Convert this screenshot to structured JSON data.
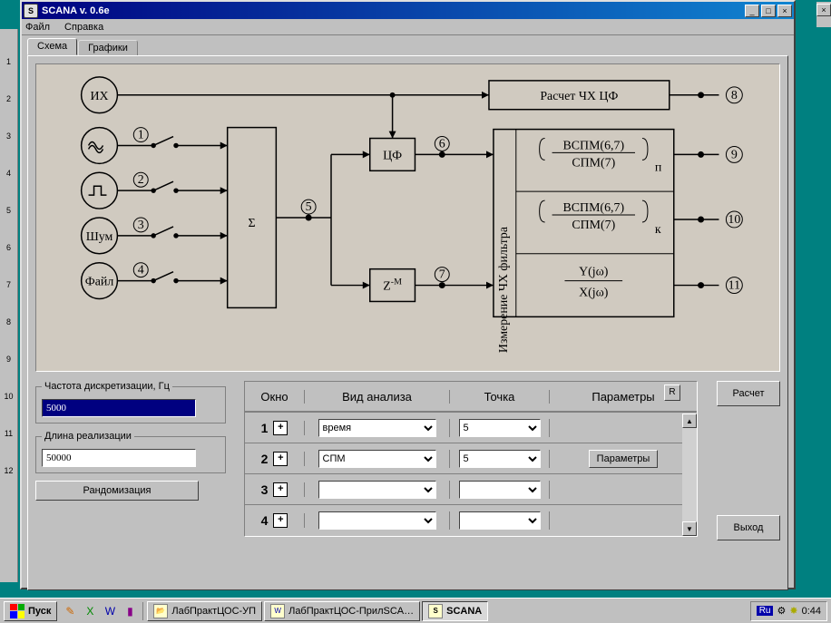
{
  "window": {
    "title": "SCANA v. 0.6e",
    "sysicon": "S"
  },
  "menu": {
    "file": "Файл",
    "help": "Справка"
  },
  "tabs": {
    "schema": "Схема",
    "graphs": "Графики"
  },
  "diagram": {
    "nodes": {
      "ih": "ИХ",
      "wave": "≈",
      "pulse": "⎍",
      "noise": "Шум",
      "file": "Файл",
      "sum": "Σ",
      "cf_filter": "ЦФ",
      "delay": "Z⁻ᴹ",
      "calc_chcf": "Расчет ЧХ ЦФ",
      "measure_block": "Измерение ЧХ фильтра",
      "ratio1_top": "ВСПМ(6,7)",
      "ratio1_bot": "СПМ(7)",
      "ratio1_sub": "п",
      "ratio2_top": "ВСПМ(6,7)",
      "ratio2_bot": "СПМ(7)",
      "ratio2_sub": "к",
      "ratio3_top": "Y(jω)",
      "ratio3_bot": "X(jω)"
    },
    "labels": {
      "n1": "1",
      "n2": "2",
      "n3": "3",
      "n4": "4",
      "n5": "5",
      "n6": "6",
      "n7": "7",
      "n8": "8",
      "n9": "9",
      "n10": "10",
      "n11": "11"
    }
  },
  "params": {
    "sample_rate_label": "Частота дискретизации, Гц",
    "sample_rate_value": "5000",
    "length_label": "Длина реализации",
    "length_value": "50000",
    "randomize": "Рандомизация"
  },
  "analysis": {
    "headers": {
      "okno": "Окно",
      "vid": "Вид анализа",
      "pt": "Точка",
      "par": "Параметры"
    },
    "r_btn": "R",
    "plus": "+",
    "rows": [
      {
        "n": "1",
        "vid": "время",
        "pt": "5",
        "par": ""
      },
      {
        "n": "2",
        "vid": "СПМ",
        "pt": "5",
        "par": "Параметры"
      },
      {
        "n": "3",
        "vid": "",
        "pt": "",
        "par": ""
      },
      {
        "n": "4",
        "vid": "",
        "pt": "",
        "par": ""
      }
    ]
  },
  "actions": {
    "calc": "Расчет",
    "exit": "Выход"
  },
  "taskbar": {
    "start": "Пуск",
    "items": [
      "ЛабПрактЦОС-УП",
      "ЛабПрактЦОС-ПрилSCA…",
      "SCANA"
    ],
    "lang": "Ru",
    "clock": "0:44"
  },
  "ruler_ticks": [
    "1",
    "2",
    "3",
    "4",
    "5",
    "6",
    "7",
    "8",
    "9",
    "10",
    "11",
    "12"
  ]
}
